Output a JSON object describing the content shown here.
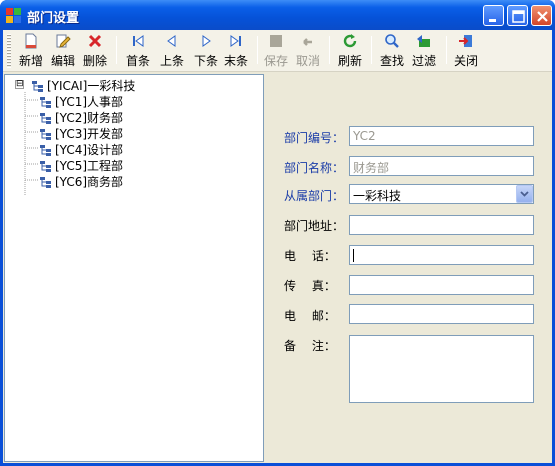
{
  "window": {
    "title": "部门设置"
  },
  "toolbar": {
    "items": [
      {
        "label": "新增",
        "icon": "new-document-icon",
        "enabled": true
      },
      {
        "label": "编辑",
        "icon": "edit-icon",
        "enabled": true
      },
      {
        "label": "删除",
        "icon": "delete-icon",
        "enabled": true
      },
      {
        "label": "首条",
        "icon": "first-record-icon",
        "enabled": true
      },
      {
        "label": "上条",
        "icon": "previous-record-icon",
        "enabled": true
      },
      {
        "label": "下条",
        "icon": "next-record-icon",
        "enabled": true
      },
      {
        "label": "末条",
        "icon": "last-record-icon",
        "enabled": true
      },
      {
        "label": "保存",
        "icon": "save-icon",
        "enabled": false
      },
      {
        "label": "取消",
        "icon": "undo-icon",
        "enabled": false
      },
      {
        "label": "刷新",
        "icon": "refresh-icon",
        "enabled": true
      },
      {
        "label": "查找",
        "icon": "find-icon",
        "enabled": true
      },
      {
        "label": "过滤",
        "icon": "filter-icon",
        "enabled": true
      },
      {
        "label": "关闭",
        "icon": "exit-icon",
        "enabled": true
      }
    ]
  },
  "tree": {
    "root": {
      "label": "[YICAI]一彩科技",
      "expander": "⊟"
    },
    "children": [
      {
        "label": "[YC1]人事部"
      },
      {
        "label": "[YC2]财务部"
      },
      {
        "label": "[YC3]开发部"
      },
      {
        "label": "[YC4]设计部"
      },
      {
        "label": "[YC5]工程部"
      },
      {
        "label": "[YC6]商务部"
      }
    ]
  },
  "form": {
    "dept_code": {
      "label": "部门编号：",
      "value": "YC2"
    },
    "dept_name": {
      "label": "部门名称：",
      "value": "财务部"
    },
    "parent_dept": {
      "label": "从属部门：",
      "value": "一彩科技"
    },
    "address": {
      "label": "部门地址：",
      "value": ""
    },
    "phone": {
      "label": "电　 话：",
      "value": ""
    },
    "fax": {
      "label": "传　 真：",
      "value": ""
    },
    "email": {
      "label": "电　 邮：",
      "value": ""
    },
    "remark": {
      "label": "备　 注：",
      "value": ""
    }
  },
  "colors": {
    "title_bar": "#0a5fe8",
    "form_label_blue": "#1a3ca8",
    "disabled_text": "#9a9890"
  }
}
